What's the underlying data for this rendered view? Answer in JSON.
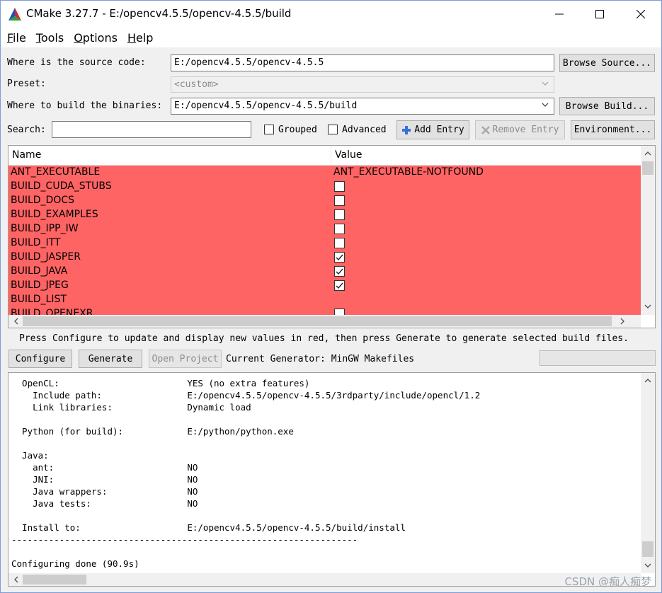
{
  "window": {
    "title": "CMake 3.27.7 - E:/opencv4.5.5/opencv-4.5.5/build"
  },
  "menu": {
    "items": [
      {
        "label": "File",
        "mnemonic": "F",
        "rest": "ile"
      },
      {
        "label": "Tools",
        "mnemonic": "T",
        "rest": "ools"
      },
      {
        "label": "Options",
        "mnemonic": "O",
        "rest": "ptions"
      },
      {
        "label": "Help",
        "mnemonic": "H",
        "rest": "elp"
      }
    ]
  },
  "form": {
    "source_label": "Where is the source code:",
    "source_value": "E:/opencv4.5.5/opencv-4.5.5",
    "browse_source": "Browse Source...",
    "preset_label": "Preset:",
    "preset_value": "<custom>",
    "binaries_label": "Where to build the binaries:",
    "binaries_value": "E:/opencv4.5.5/opencv-4.5.5/build",
    "browse_build": "Browse Build...",
    "search_label": "Search:",
    "search_value": "",
    "grouped_label": "Grouped",
    "grouped_checked": false,
    "advanced_label": "Advanced",
    "advanced_checked": false,
    "add_entry": "Add Entry",
    "remove_entry": "Remove Entry",
    "environment": "Environment..."
  },
  "table": {
    "columns": [
      "Name",
      "Value"
    ],
    "rows": [
      {
        "name": "ANT_EXECUTABLE",
        "type": "text",
        "value": "ANT_EXECUTABLE-NOTFOUND"
      },
      {
        "name": "BUILD_CUDA_STUBS",
        "type": "bool",
        "checked": false
      },
      {
        "name": "BUILD_DOCS",
        "type": "bool",
        "checked": false
      },
      {
        "name": "BUILD_EXAMPLES",
        "type": "bool",
        "checked": false
      },
      {
        "name": "BUILD_IPP_IW",
        "type": "bool",
        "checked": false
      },
      {
        "name": "BUILD_ITT",
        "type": "bool",
        "checked": false
      },
      {
        "name": "BUILD_JASPER",
        "type": "bool",
        "checked": true
      },
      {
        "name": "BUILD_JAVA",
        "type": "bool",
        "checked": true
      },
      {
        "name": "BUILD_JPEG",
        "type": "bool",
        "checked": true
      },
      {
        "name": "BUILD_LIST",
        "type": "text",
        "value": ""
      },
      {
        "name": "BUILD_OPENEXR",
        "type": "bool",
        "checked": false
      }
    ],
    "row_color": "#ff6464"
  },
  "status": {
    "message": "Press Configure to update and display new values in red, then press Generate to generate selected build files."
  },
  "actions": {
    "configure": "Configure",
    "generate": "Generate",
    "open_project": "Open Project",
    "generator_text": "Current Generator: MinGW Makefiles"
  },
  "log": {
    "lines": [
      "  OpenCL:                        YES (no extra features)",
      "    Include path:                E:/opencv4.5.5/opencv-4.5.5/3rdparty/include/opencl/1.2",
      "    Link libraries:              Dynamic load",
      "",
      "  Python (for build):            E:/python/python.exe",
      "",
      "  Java:",
      "    ant:                         NO",
      "    JNI:                         NO",
      "    Java wrappers:               NO",
      "    Java tests:                  NO",
      "",
      "  Install to:                    E:/opencv4.5.5/opencv-4.5.5/build/install",
      "-----------------------------------------------------------------",
      "",
      "Configuring done (90.9s)"
    ]
  },
  "watermark": "CSDN @痴人痴梦"
}
